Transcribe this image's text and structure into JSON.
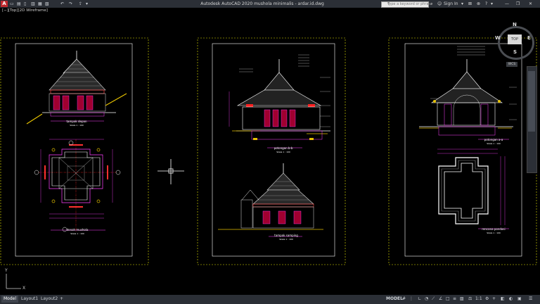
{
  "app": {
    "title": "Autodesk AutoCAD 2020   mushola minimalis - ardar.id.dwg",
    "logo_letter": "A",
    "search_placeholder": "Type a keyword or phrase",
    "sign_in": "Sign In",
    "help_icon": "?"
  },
  "viewport": {
    "label": "[−][Top][2D Wireframe]"
  },
  "viewcube": {
    "north": "N",
    "south": "S",
    "east": "E",
    "west": "W",
    "face": "TOP",
    "wcs": "WCS"
  },
  "drawings": {
    "sheet1": {
      "title1": "tampak depan",
      "scale1": "Skala 1 : 100",
      "title2": "denah mushola",
      "scale2": "Skala 1 : 100"
    },
    "sheet2": {
      "title1": "potongan b-b",
      "scale1": "Skala 1 : 100",
      "title2": "tampak samping",
      "scale2": "Skala 1 : 100"
    },
    "sheet3": {
      "title1": "potongan a-a",
      "scale1": "Skala 1 : 100",
      "title2": "rencana pondasi",
      "scale2": "Skala 1 : 100"
    }
  },
  "ucs": {
    "y": "Y",
    "x": "X"
  },
  "statusbar": {
    "tabs": [
      "Model",
      "Layout1",
      "Layout2",
      "+"
    ],
    "active_tab": "Model",
    "model_label": "MODEL",
    "scale": "1:1"
  },
  "colors": {
    "background": "#000000",
    "ui_bar": "#2b2f36",
    "magenta": "#ff00ff",
    "red": "#ff2020",
    "yellow": "#ffff00",
    "white": "#ffffff",
    "cyan": "#00ffff"
  }
}
